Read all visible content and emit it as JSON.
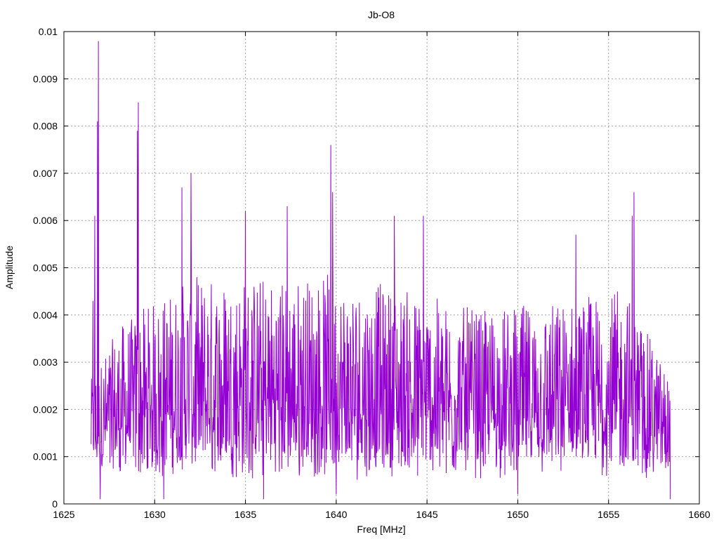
{
  "chart_data": {
    "type": "line",
    "title": "Jb-O8",
    "xlabel": "Freq [MHz]",
    "ylabel": "Amplitude",
    "xlim": [
      1625,
      1660
    ],
    "ylim": [
      0,
      0.01
    ],
    "x_ticks": [
      "1625",
      "1630",
      "1635",
      "1640",
      "1645",
      "1650",
      "1655",
      "1660"
    ],
    "y_ticks": [
      "0",
      "0.001",
      "0.002",
      "0.003",
      "0.004",
      "0.005",
      "0.006",
      "0.007",
      "0.008",
      "0.009",
      "0.01"
    ],
    "grid": true,
    "line_color": "#9400d3",
    "series": [
      {
        "x_start": 1626.5,
        "x_end": 1658.4,
        "peaks": [
          {
            "x": 1626.9,
            "y": 0.0098
          },
          {
            "x": 1626.85,
            "y": 0.0081
          },
          {
            "x": 1626.7,
            "y": 0.0061
          },
          {
            "x": 1626.6,
            "y": 0.0043
          },
          {
            "x": 1629.1,
            "y": 0.0085
          },
          {
            "x": 1629.05,
            "y": 0.0079
          },
          {
            "x": 1631.5,
            "y": 0.0067
          },
          {
            "x": 1632.0,
            "y": 0.007
          },
          {
            "x": 1635.0,
            "y": 0.0062
          },
          {
            "x": 1637.3,
            "y": 0.0063
          },
          {
            "x": 1639.7,
            "y": 0.0076
          },
          {
            "x": 1639.8,
            "y": 0.0066
          },
          {
            "x": 1643.2,
            "y": 0.0061
          },
          {
            "x": 1644.8,
            "y": 0.0061
          },
          {
            "x": 1653.2,
            "y": 0.0057
          },
          {
            "x": 1656.4,
            "y": 0.0066
          },
          {
            "x": 1656.3,
            "y": 0.0061
          }
        ],
        "troughs": [
          {
            "x": 1627.0,
            "y": 0.0001
          },
          {
            "x": 1630.5,
            "y": 0.0001
          },
          {
            "x": 1636.0,
            "y": 0.0001
          },
          {
            "x": 1640.0,
            "y": 0.0002
          },
          {
            "x": 1650.0,
            "y": 0.0002
          },
          {
            "x": 1658.4,
            "y": 0.0001
          }
        ],
        "envelope": [
          {
            "x": 1626.5,
            "y": 0.0025
          },
          {
            "x": 1628.0,
            "y": 0.0035
          },
          {
            "x": 1632.0,
            "y": 0.0045
          },
          {
            "x": 1636.0,
            "y": 0.0045
          },
          {
            "x": 1640.0,
            "y": 0.0045
          },
          {
            "x": 1644.0,
            "y": 0.0042
          },
          {
            "x": 1648.0,
            "y": 0.0038
          },
          {
            "x": 1652.0,
            "y": 0.004
          },
          {
            "x": 1656.0,
            "y": 0.0042
          },
          {
            "x": 1658.4,
            "y": 0.0025
          }
        ]
      }
    ]
  }
}
